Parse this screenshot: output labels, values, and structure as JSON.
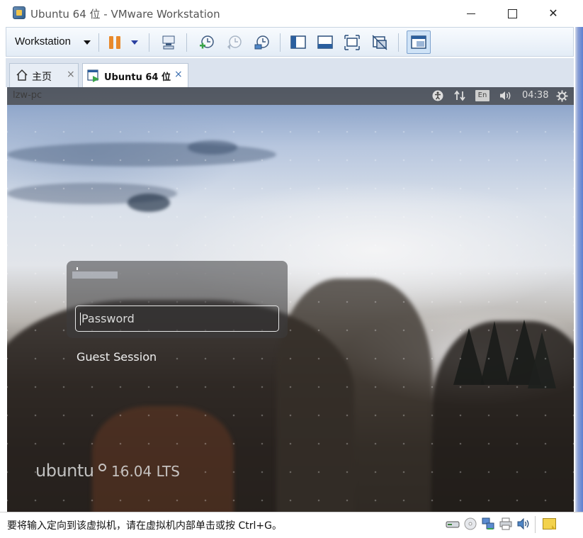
{
  "window": {
    "title": "Ubuntu 64 位 - VMware Workstation"
  },
  "toolbar": {
    "workstation_menu": "Workstation"
  },
  "tabs": [
    {
      "label": "主页",
      "close": "×",
      "icon": "home-icon"
    },
    {
      "label": "Ubuntu 64 位",
      "close": "×",
      "icon": "vm-running-icon"
    }
  ],
  "guest": {
    "hostname": "lzw-pc",
    "keyboard_layout": "En",
    "clock": "04:38",
    "password_placeholder": "Password",
    "guest_session": "Guest Session",
    "brand": "ubuntu",
    "version": "16.04 LTS"
  },
  "statusbar": {
    "message": "要将输入定向到该虚拟机，请在虚拟机内部单击或按 Ctrl+G。"
  },
  "colors": {
    "pause": "#e8892b",
    "accent": "#2a3fa0",
    "toolbar_bg": "#e3ecf6"
  }
}
